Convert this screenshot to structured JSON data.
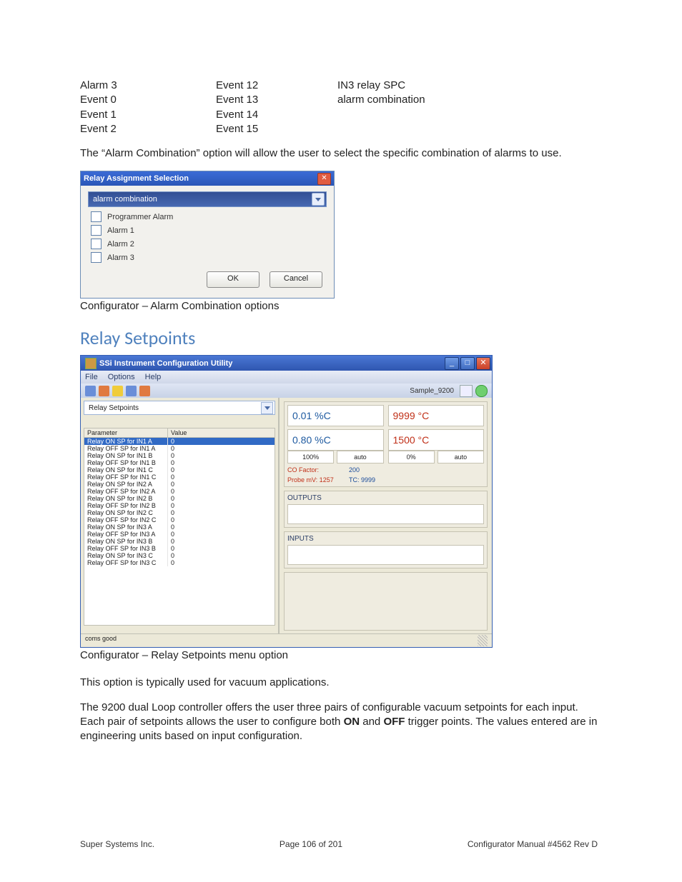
{
  "top_columns": {
    "col1": [
      "Alarm 3",
      "Event 0",
      "Event 1",
      "Event 2"
    ],
    "col2": [
      "Event 12",
      "Event 13",
      "Event 14",
      "Event 15"
    ],
    "col3": [
      "IN3 relay SPC",
      "alarm combination"
    ]
  },
  "para1": "The “Alarm Combination” option will allow the user to select the specific combination of alarms to use.",
  "dialog1": {
    "title": "Relay Assignment Selection",
    "dropdown": "alarm combination",
    "options": [
      "Programmer Alarm",
      "Alarm 1",
      "Alarm 2",
      "Alarm 3"
    ],
    "ok": "OK",
    "cancel": "Cancel"
  },
  "caption1": "Configurator – Alarm Combination options",
  "section_heading": "Relay Setpoints",
  "app": {
    "title": "SSi Instrument Configuration Utility",
    "menu": [
      "File",
      "Options",
      "Help"
    ],
    "toolbar": {
      "sample_label": "Sample_9200",
      "icon_colors": [
        "#6a8ed8",
        "#e07a40",
        "#f0cc3a",
        "#6a8ed8",
        "#e07a40"
      ]
    },
    "combo": "Relay Setpoints",
    "grid": {
      "headers": [
        "Parameter",
        "Value"
      ],
      "rows": [
        {
          "p": "Relay ON SP for IN1 A",
          "v": "0",
          "sel": true
        },
        {
          "p": "Relay OFF SP for IN1 A",
          "v": "0"
        },
        {
          "p": "Relay ON SP for IN1 B",
          "v": "0"
        },
        {
          "p": "Relay OFF SP for IN1 B",
          "v": "0"
        },
        {
          "p": "Relay ON SP for IN1 C",
          "v": "0"
        },
        {
          "p": "Relay OFF SP for IN1 C",
          "v": "0"
        },
        {
          "p": "Relay ON SP for IN2 A",
          "v": "0"
        },
        {
          "p": "Relay OFF SP for IN2 A",
          "v": "0"
        },
        {
          "p": "Relay ON SP for IN2 B",
          "v": "0"
        },
        {
          "p": "Relay OFF SP for IN2 B",
          "v": "0"
        },
        {
          "p": "Relay ON SP for IN2 C",
          "v": "0"
        },
        {
          "p": "Relay OFF SP for IN2 C",
          "v": "0"
        },
        {
          "p": "Relay ON SP for IN3 A",
          "v": "0"
        },
        {
          "p": "Relay OFF SP for IN3 A",
          "v": "0"
        },
        {
          "p": "Relay ON SP for IN3 B",
          "v": "0"
        },
        {
          "p": "Relay OFF SP for IN3 B",
          "v": "0"
        },
        {
          "p": "Relay ON SP for IN3 C",
          "v": "0"
        },
        {
          "p": "Relay OFF SP for IN3 C",
          "v": "0"
        }
      ]
    },
    "readouts": {
      "carbon_pv": "0.01 %C",
      "temp_pv": "9999 °C",
      "carbon_sp": "0.80 %C",
      "temp_sp": "1500 °C",
      "l1": "100%",
      "l2": "auto",
      "r1": "0%",
      "r2": "auto",
      "co_label": "CO Factor:",
      "co_val": "200",
      "probe_label": "Probe mV: 1257",
      "tc_label": "TC: 9999"
    },
    "outputs_label": "OUTPUTS",
    "inputs_label": "INPUTS",
    "status": "coms good"
  },
  "caption2": "Configurator – Relay Setpoints menu option",
  "para2": "This option is typically used for vacuum applications.",
  "para3a": "The 9200 dual Loop controller offers the user three pairs of configurable vacuum setpoints for each input. Each pair of setpoints allows the user to configure both ",
  "para3b": " and ",
  "para3c": " trigger points. The values entered are in engineering units based on input configuration.",
  "on": "ON",
  "off": "OFF",
  "footer": {
    "left": "Super Systems Inc.",
    "center": "Page 106 of 201",
    "right": "Configurator Manual #4562 Rev D"
  }
}
